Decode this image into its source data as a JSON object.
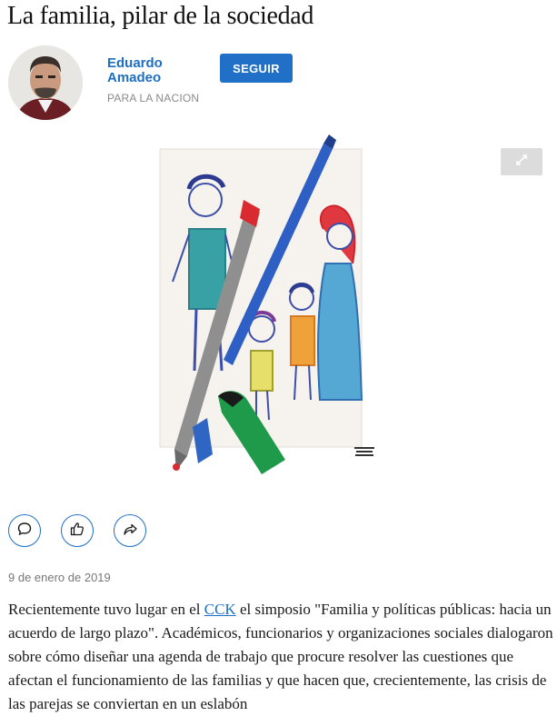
{
  "article": {
    "title": "La familia, pilar de la sociedad",
    "date": "9 de enero de 2019",
    "body": {
      "before_link": "Recientemente tuvo lugar en el ",
      "link_text": "CCK",
      "after_link": " el simposio \"Familia y políticas públicas: hacia un acuerdo de largo plazo\". Académicos, funcionarios y organizaciones sociales dialogaron sobre cómo diseñar una agenda de trabajo que procure resolver las cuestiones que afectan el funcionamiento de las familias y que hacen que, crecientemente, las crisis de las parejas se conviertan en un eslabón"
    }
  },
  "author": {
    "name": "Eduardo Amadeo",
    "org": "PARA LA NACION",
    "follow_label": "SEGUIR"
  },
  "icons": {
    "expand": "expand-icon",
    "comment": "comment-icon",
    "like": "thumbs-up-icon",
    "share": "share-icon"
  },
  "colors": {
    "accent": "#1f70c6",
    "author_name": "#1e6fc0"
  }
}
